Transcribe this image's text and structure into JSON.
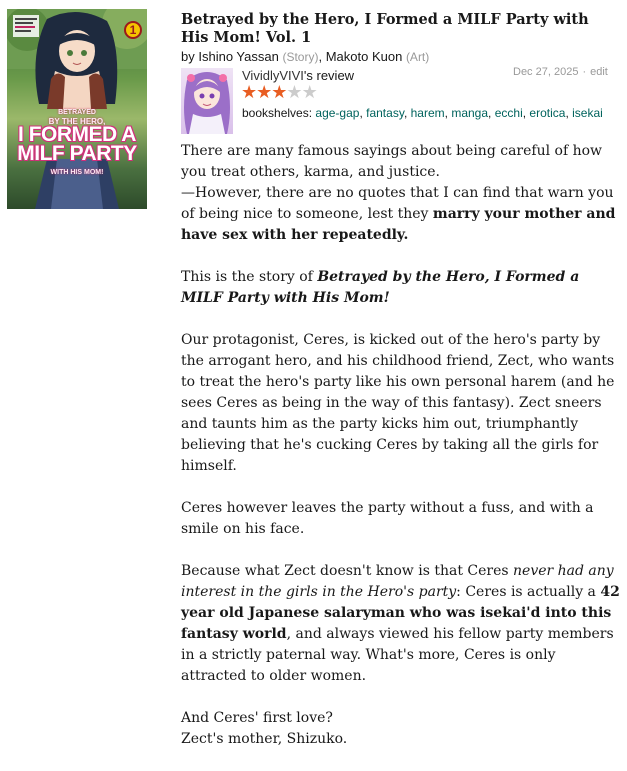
{
  "book": {
    "title": "Betrayed by the Hero, I Formed a MILF Party with His Mom! Vol. 1",
    "by_label": "by",
    "author1": "Ishino Yassan",
    "author1_role": "(Story)",
    "separator": ",",
    "author2": "Makoto Kuon",
    "author2_role": "(Art)",
    "cover": {
      "volume_number": "1",
      "line1": "BETRAYED",
      "line2": "BY THE HERO,",
      "line3a": "I FORMED A",
      "line3b": "MILF PARTY",
      "line4": "WITH HIS MOM!"
    }
  },
  "review_header": {
    "reviewer_name": "VividlyVIVI",
    "review_suffix": "'s review",
    "date": "Dec 27, 2025",
    "date_separator": "·",
    "edit_label": "edit",
    "rating": 3,
    "max_rating": 5,
    "shelves_label": "bookshelves:",
    "shelves": [
      "age-gap",
      "fantasy",
      "harem",
      "manga",
      "ecchi",
      "erotica",
      "isekai"
    ]
  },
  "review": {
    "p1_a": "There are many famous sayings about being careful of how you treat others, karma, and justice.",
    "p1_b": "—However, there are no quotes that I can find that warn you of being nice to someone, lest they ",
    "p1_bold": "marry your mother and have sex with her repeatedly.",
    "p2_a": "This is the story of ",
    "p2_bold_italic": "Betrayed by the Hero, I Formed a MILF Party with His Mom!",
    "p3": "Our protagonist, Ceres, is kicked out of the hero's party by the arrogant hero, and his childhood friend, Zect, who wants to treat the hero's party like his own personal harem (and he sees Ceres as being in the way of this fantasy). Zect sneers and taunts him as the party kicks him out, triumphantly believing that he's cucking Ceres by taking all the girls for himself.",
    "p4": "Ceres however leaves the party without a fuss, and with a smile on his face.",
    "p5_a": "Because what Zect doesn't know is that Ceres ",
    "p5_italic": "never had any interest in the girls in the Hero's party",
    "p5_b": ": Ceres is actually a ",
    "p5_bold": "42 year old Japanese salaryman who was isekai'd into this fantasy world",
    "p5_c": ", and always viewed his fellow party members in a strictly paternal way. What's more, Ceres is only attracted to older women.",
    "p6_a": "And Ceres' first love?",
    "p6_b": "Zect's mother, Shizuko."
  },
  "colors": {
    "link_green": "#00635d",
    "star_orange": "#e85d22",
    "star_grey": "#cccccc",
    "muted": "#999999"
  }
}
